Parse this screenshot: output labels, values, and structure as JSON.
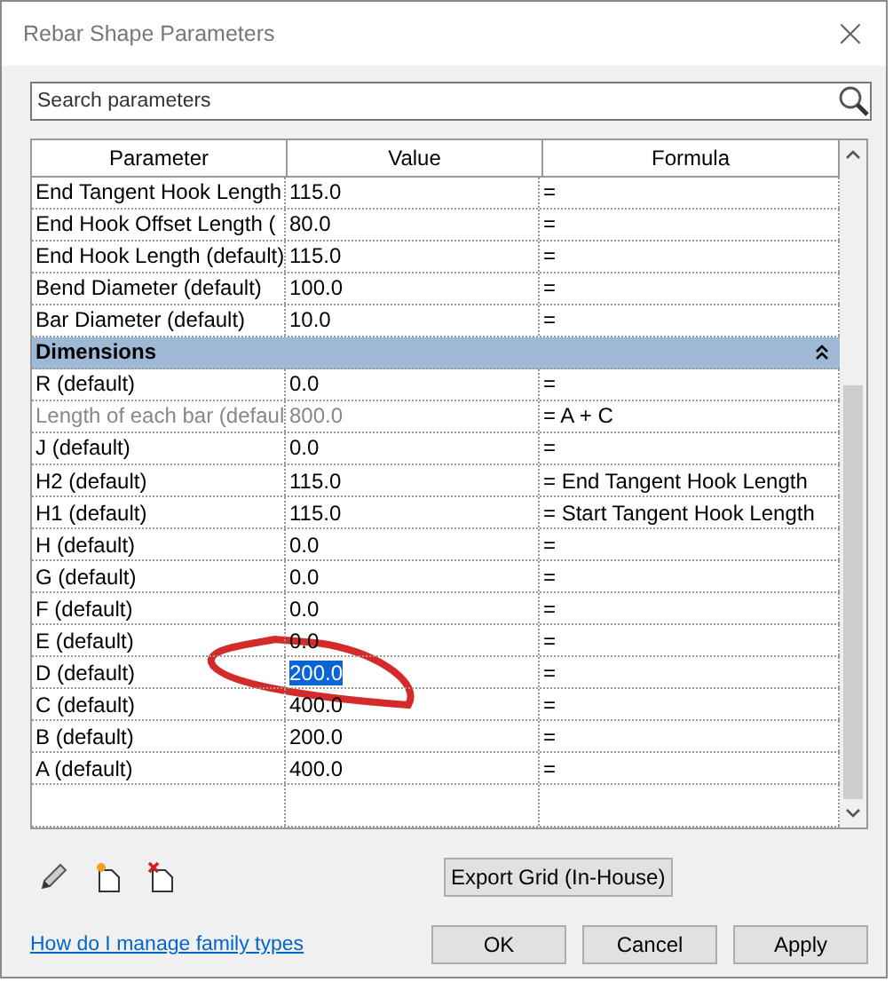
{
  "window": {
    "title": "Rebar Shape Parameters",
    "close": "×"
  },
  "search": {
    "placeholder": "Search parameters"
  },
  "table": {
    "columns": [
      "Parameter",
      "Value",
      "Formula"
    ],
    "rows": [
      {
        "kind": "param",
        "name": "End Tangent Hook Length",
        "value": "115.0",
        "formula": "=",
        "disabled": false,
        "selected": false
      },
      {
        "kind": "param",
        "name": "End Hook Offset Length (",
        "value": "80.0",
        "formula": "=",
        "disabled": false,
        "selected": false
      },
      {
        "kind": "param",
        "name": "End Hook Length (default)",
        "value": "115.0",
        "formula": "=",
        "disabled": false,
        "selected": false
      },
      {
        "kind": "param",
        "name": "Bend Diameter (default)",
        "value": "100.0",
        "formula": "=",
        "disabled": false,
        "selected": false
      },
      {
        "kind": "param",
        "name": "Bar Diameter (default)",
        "value": "10.0",
        "formula": "=",
        "disabled": false,
        "selected": false
      },
      {
        "kind": "group",
        "name": "Dimensions",
        "expanded": true
      },
      {
        "kind": "param",
        "name": "R (default)",
        "value": "0.0",
        "formula": "=",
        "disabled": false,
        "selected": false
      },
      {
        "kind": "param",
        "name": "Length of each bar (defaul",
        "value": "800.0",
        "formula": "= A + C",
        "disabled": true,
        "selected": false
      },
      {
        "kind": "param",
        "name": "J (default)",
        "value": "0.0",
        "formula": "=",
        "disabled": false,
        "selected": false
      },
      {
        "kind": "param",
        "name": "H2 (default)",
        "value": "115.0",
        "formula": "= End Tangent Hook Length",
        "disabled": false,
        "selected": false
      },
      {
        "kind": "param",
        "name": "H1 (default)",
        "value": "115.0",
        "formula": "= Start Tangent Hook Length",
        "disabled": false,
        "selected": false
      },
      {
        "kind": "param",
        "name": "H (default)",
        "value": "0.0",
        "formula": "=",
        "disabled": false,
        "selected": false
      },
      {
        "kind": "param",
        "name": "G (default)",
        "value": "0.0",
        "formula": "=",
        "disabled": false,
        "selected": false
      },
      {
        "kind": "param",
        "name": "F (default)",
        "value": "0.0",
        "formula": "=",
        "disabled": false,
        "selected": false
      },
      {
        "kind": "param",
        "name": "E (default)",
        "value": "0.0",
        "formula": "=",
        "disabled": false,
        "selected": false
      },
      {
        "kind": "param",
        "name": "D (default)",
        "value": "200.0",
        "formula": "=",
        "disabled": false,
        "selected": true
      },
      {
        "kind": "param",
        "name": "C (default)",
        "value": "400.0",
        "formula": "=",
        "disabled": false,
        "selected": false
      },
      {
        "kind": "param",
        "name": "B (default)",
        "value": "200.0",
        "formula": "=",
        "disabled": false,
        "selected": false
      },
      {
        "kind": "param",
        "name": "A (default)",
        "value": "400.0",
        "formula": "=",
        "disabled": false,
        "selected": false
      }
    ]
  },
  "export_button": "Export Grid (In-House)",
  "help_link": "How do I manage family types",
  "buttons": [
    "OK",
    "Cancel",
    "Apply"
  ]
}
